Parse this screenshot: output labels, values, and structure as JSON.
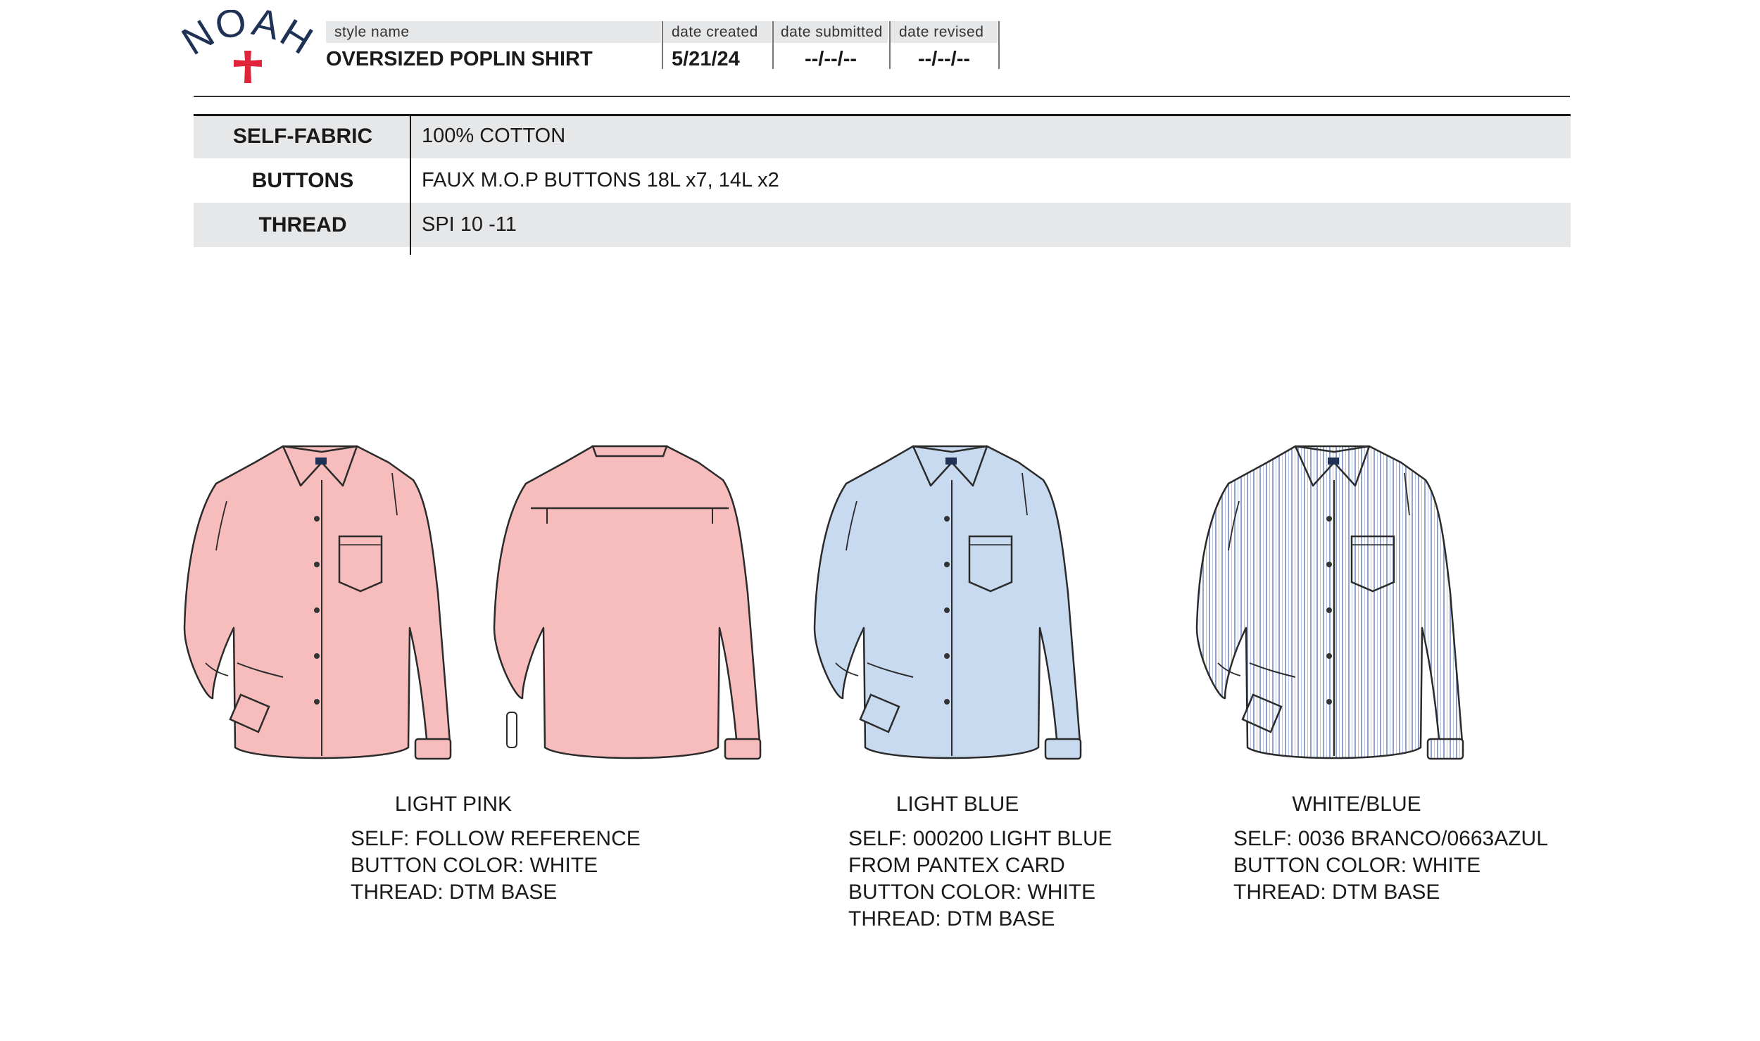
{
  "brand": {
    "name": "NOAH",
    "cross_color": "#e0253b",
    "text_color": "#1f3255"
  },
  "header": {
    "style_name_label": "style name",
    "style_name": "OVERSIZED POPLIN SHIRT",
    "date_created_label": "date created",
    "date_created": "5/21/24",
    "date_submitted_label": "date submitted",
    "date_submitted": "--/--/--",
    "date_revised_label": "date revised",
    "date_revised": "--/--/--"
  },
  "spec": [
    {
      "label": "SELF-FABRIC",
      "value": "100% COTTON"
    },
    {
      "label": "BUTTONS",
      "value": "FAUX M.O.P BUTTONS 18L x7, 14L x2"
    },
    {
      "label": "THREAD",
      "value": "SPI 10 -11"
    }
  ],
  "colorways": [
    {
      "name": "LIGHT PINK",
      "fill": "#f7bcbc",
      "lines": [
        "SELF: FOLLOW REFERENCE",
        "BUTTON COLOR: WHITE",
        "THREAD: DTM BASE"
      ]
    },
    {
      "name": "LIGHT BLUE",
      "fill": "#c7daf0",
      "lines": [
        "SELF: 000200 LIGHT BLUE",
        "FROM PANTEX CARD",
        "BUTTON COLOR: WHITE",
        "THREAD: DTM BASE"
      ]
    },
    {
      "name": "WHITE/BLUE",
      "fill": "#ffffff",
      "stripe": "#8fa3cf",
      "lines": [
        "SELF: 0036 BRANCO/0663AZUL",
        "BUTTON COLOR: WHITE",
        "THREAD: DTM BASE"
      ]
    }
  ]
}
